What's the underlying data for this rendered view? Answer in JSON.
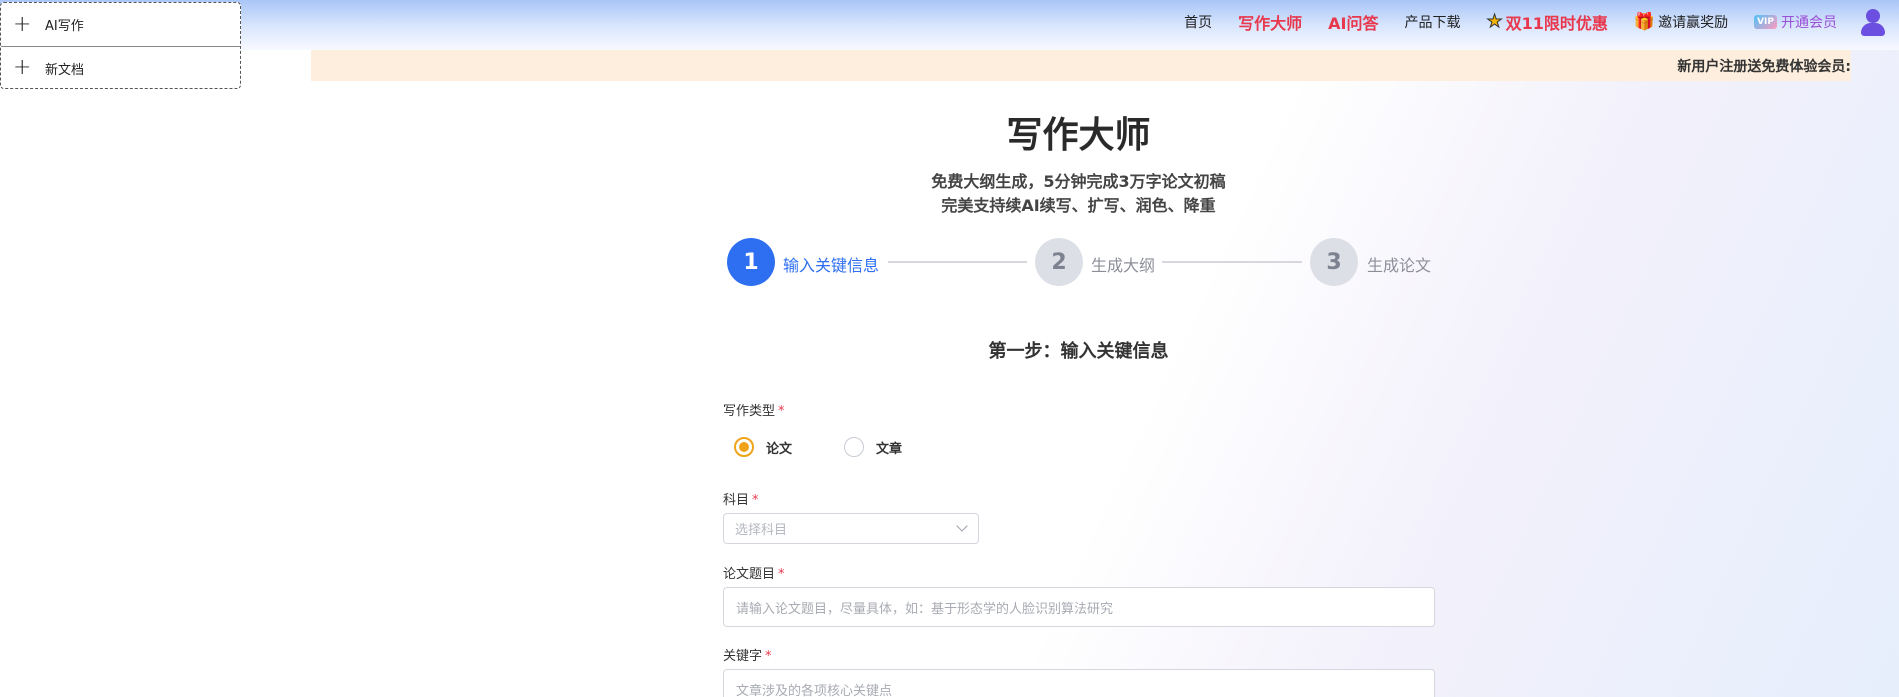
{
  "nav": {
    "home": "首页",
    "writing_master": "写作大师",
    "ai_qa": "AI问答",
    "download": "产品下载",
    "promo": "双11限时优惠",
    "invite": "邀请赢奖励",
    "vip": "开通会员",
    "vip_badge": "VIP"
  },
  "dropdown": {
    "items": [
      {
        "label": "AI写作"
      },
      {
        "label": "新文档"
      }
    ]
  },
  "notice": {
    "text": "新用户注册送免费体验会员:"
  },
  "hero": {
    "title": "写作大师",
    "subtitle1": "免费大纲生成，5分钟完成3万字论文初稿",
    "subtitle2": "完美支持续AI续写、扩写、润色、降重"
  },
  "steps": [
    {
      "num": "1",
      "label": "输入关键信息"
    },
    {
      "num": "2",
      "label": "生成大纲"
    },
    {
      "num": "3",
      "label": "生成论文"
    }
  ],
  "form": {
    "section_title": "第一步：输入关键信息",
    "required_mark": "*",
    "type_label": "写作类型",
    "type_options": [
      "论文",
      "文章"
    ],
    "type_selected": "论文",
    "subject_label": "科目",
    "subject_placeholder": "选择科目",
    "title_label": "论文题目",
    "title_placeholder": "请输入论文题目，尽量具体，如：基于形态学的人脸识别算法研究",
    "keywords_label": "关键字",
    "keywords_placeholder": "文章涉及的各项核心关键点"
  },
  "colors": {
    "primary": "#2d6ff0",
    "accent_red": "#e8384d",
    "radio_checked": "#f0a31a",
    "notice_bg": "#fdeedd"
  }
}
